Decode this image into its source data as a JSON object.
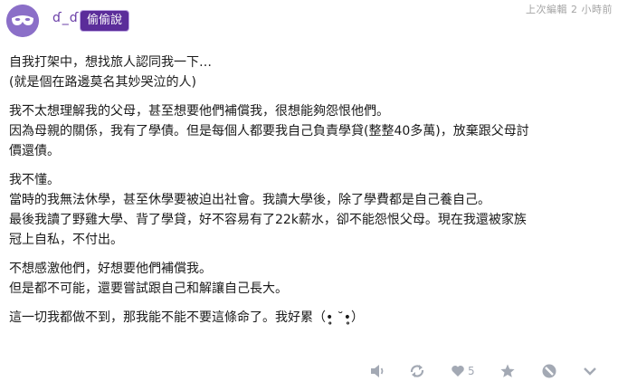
{
  "post": {
    "author": "ɗ_ɗ",
    "badge": "偷偷說",
    "edited": "上次編輯 2 小時前",
    "paragraphs": [
      [
        "自我打架中，想找旅人認同我一下…",
        "(就是個在路邊莫名其妙哭泣的人)"
      ],
      [
        "我不太想理解我的父母，甚至想要他們補償我，很想能夠怨恨他們。",
        "因為母親的關係，我有了學債。但是每個人都要我自己負責學貸(整整40多萬)，放棄跟父母討",
        "價還債。"
      ],
      [
        "我不懂。",
        "當時的我無法休學，甚至休學要被迫出社會。我讀大學後，除了學費都是自己養自己。",
        "最後我讀了野雞大學、背了學貸，好不容易有了22k薪水，卻不能怨恨父母。現在我還被家族",
        "冠上自私，不付出。"
      ],
      [
        "不想感激他們，好想要他們補償我。",
        "但是都不可能，還要嘗試跟自己和解讓自己長大。"
      ],
      [
        "這一切我都做不到，那我能不能不要這條命了。我好累（•̥̥̥ ˘•̥̥̥）"
      ]
    ]
  },
  "toolbar": {
    "like_count": "5",
    "icons": [
      "volume-icon",
      "share-icon",
      "heart-icon",
      "star-icon",
      "block-icon",
      "chevron-down-icon"
    ]
  },
  "colors": {
    "badge_bg": "#5b2d9a",
    "author": "#6b3fa8",
    "toolbar_icon": "#a3a9b4"
  }
}
